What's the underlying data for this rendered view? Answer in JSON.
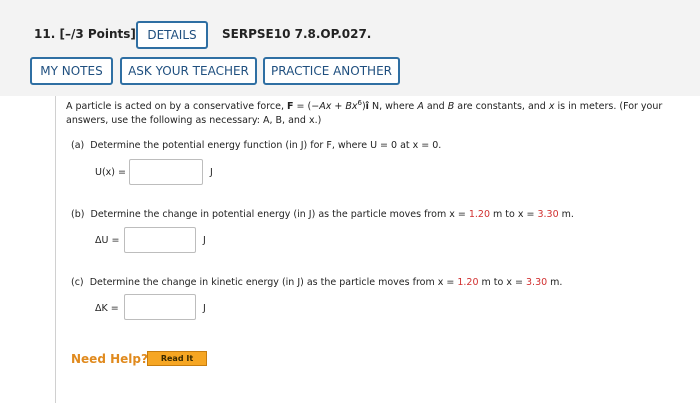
{
  "question": {
    "number": "11.",
    "points": "[–/3 Points]",
    "details_label": "DETAILS",
    "code": "SERPSE10 7.8.OP.027."
  },
  "toolbar": {
    "my_notes": "MY NOTES",
    "ask_teacher": "ASK YOUR TEACHER",
    "practice_another": "PRACTICE ANOTHER"
  },
  "intro": {
    "p1": "A particle is acted on by a conservative force, ",
    "force_symbol": "F",
    "p2": " = (−",
    "A": "A",
    "x1": "x",
    "p3": " + ",
    "B": "B",
    "x2": "x",
    "exp": "6",
    "p4": ")",
    "i_hat": "î",
    "p5": " N, where ",
    "A2": "A",
    "p6": " and ",
    "B2": "B",
    "p7": " are constants, and ",
    "x3": "x",
    "p8": " is in meters. (For your",
    "line2": "answers, use the following as necessary: A, B, and x.)"
  },
  "part_a": {
    "tag": "(a)",
    "text": "Determine the potential energy function (in J) for F, where U = 0 at x = 0.",
    "label": "U(x) =",
    "unit": "J",
    "value": ""
  },
  "part_b": {
    "tag": "(b)",
    "text_pre": "Determine the change in potential energy (in J) as the particle moves from x = ",
    "x_from": "1.20",
    "text_mid": " m to x = ",
    "x_to": "3.30",
    "text_post": " m.",
    "label": "ΔU =",
    "unit": "J",
    "value": ""
  },
  "part_c": {
    "tag": "(c)",
    "text_pre": "Determine the change in kinetic energy (in J) as the particle moves from x = ",
    "x_from": "1.20",
    "text_mid": " m to x = ",
    "x_to": "3.30",
    "text_post": " m.",
    "label": "ΔK =",
    "unit": "J",
    "value": ""
  },
  "help": {
    "title": "Need Help?",
    "read_it": "Read It"
  },
  "colors": {
    "button_border": "#2f6fa3",
    "highlight_red": "#d12f2f",
    "help_orange": "#e08a1e",
    "readit_bg": "#f6a623"
  }
}
